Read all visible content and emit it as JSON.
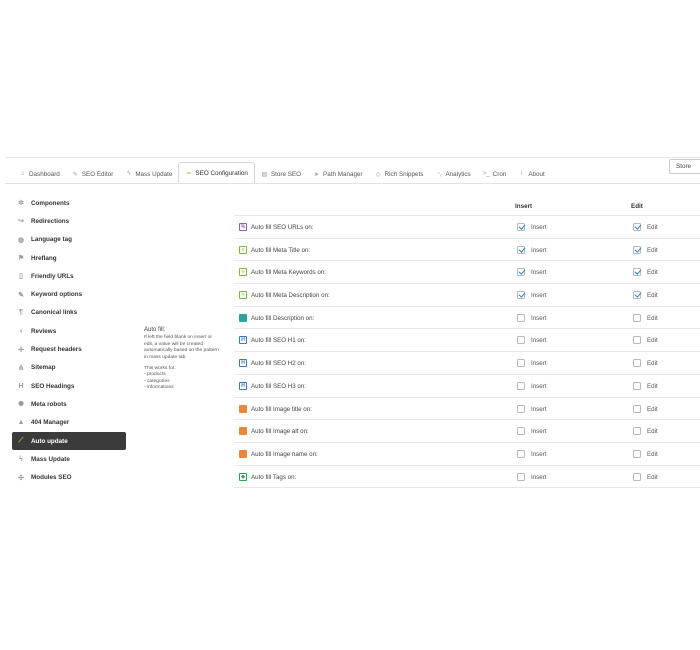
{
  "tabs": [
    {
      "label": "Dashboard",
      "icon": "home-icon"
    },
    {
      "label": "SEO Editor",
      "icon": "edit-icon"
    },
    {
      "label": "Mass Update",
      "icon": "bolt-icon"
    },
    {
      "label": "SEO Configuration",
      "icon": "wrench-icon",
      "active": true
    },
    {
      "label": "Store SEO",
      "icon": "store-icon"
    },
    {
      "label": "Path Manager",
      "icon": "send-icon"
    },
    {
      "label": "Rich Snippets",
      "icon": "tag-icon"
    },
    {
      "label": "Analytics",
      "icon": "chart-icon"
    },
    {
      "label": "Cron",
      "icon": "terminal-icon"
    },
    {
      "label": "About",
      "icon": "info-icon"
    }
  ],
  "store_select": {
    "value": "Store"
  },
  "sidebar": {
    "items": [
      {
        "label": "Components",
        "icon": "gear-icon"
      },
      {
        "label": "Redirections",
        "icon": "share-icon"
      },
      {
        "label": "Language tag",
        "icon": "globe-icon"
      },
      {
        "label": "Hreflang",
        "icon": "flag-icon"
      },
      {
        "label": "Friendly URLs",
        "icon": "file-icon"
      },
      {
        "label": "Keyword options",
        "icon": "edit-icon"
      },
      {
        "label": "Canonical links",
        "icon": "paragraph-icon"
      },
      {
        "label": "Reviews",
        "icon": "comment-icon"
      },
      {
        "label": "Request headers",
        "icon": "crosshair-icon"
      },
      {
        "label": "Sitemap",
        "icon": "sitemap-icon"
      },
      {
        "label": "SEO Headings",
        "icon": "heading-icon"
      },
      {
        "label": "Meta robots",
        "icon": "robot-icon"
      },
      {
        "label": "404 Manager",
        "icon": "warning-icon"
      },
      {
        "label": "Auto update",
        "icon": "wand-icon",
        "active": true
      },
      {
        "label": "Mass Update",
        "icon": "bolt-icon"
      },
      {
        "label": "Modules SEO",
        "icon": "puzzle-icon"
      }
    ]
  },
  "help": {
    "title": "Auto fill:",
    "lines": [
      "If left the field blank on insert or",
      "edit, a value will be created",
      "automatically based on the pattern",
      "in mass update tab."
    ],
    "works_title": "This works for:",
    "works": [
      "- products",
      "- categories",
      "- informations"
    ]
  },
  "table": {
    "insert_header": "Insert",
    "edit_header": "Edit",
    "insert_label": "Insert",
    "edit_label": "Edit",
    "rows": [
      {
        "label": "Auto fill SEO URLs on:",
        "icon": "link-icon",
        "color": "#8a63b8",
        "glyph": "%",
        "insert": true,
        "edit": true
      },
      {
        "label": "Auto fill Meta Title on:",
        "icon": "code-icon",
        "color": "#78b83a",
        "glyph": "‹›",
        "insert": true,
        "edit": true
      },
      {
        "label": "Auto fill Meta Keywords on:",
        "icon": "code-icon",
        "color": "#78b83a",
        "glyph": "‹›",
        "insert": true,
        "edit": true
      },
      {
        "label": "Auto fill Meta Description on:",
        "icon": "code-icon",
        "color": "#78b83a",
        "glyph": "‹›",
        "insert": true,
        "edit": true
      },
      {
        "label": "Auto fill Description on:",
        "icon": "image-icon",
        "color": "#2aa39a",
        "glyph": "▆",
        "insert": false,
        "edit": false
      },
      {
        "label": "Auto fill SEO H1 on:",
        "icon": "heading-icon",
        "color": "#3a78b8",
        "glyph": "H",
        "insert": false,
        "edit": false
      },
      {
        "label": "Auto fill SEO H2 on:",
        "icon": "heading-icon",
        "color": "#3a78b8",
        "glyph": "H",
        "insert": false,
        "edit": false
      },
      {
        "label": "Auto fill SEO H3 on:",
        "icon": "heading-icon",
        "color": "#3a78b8",
        "glyph": "H",
        "insert": false,
        "edit": false
      },
      {
        "label": "Auto fill Image title on:",
        "icon": "image-icon",
        "color": "#e8893a",
        "glyph": "▆",
        "insert": false,
        "edit": false
      },
      {
        "label": "Auto fill Image alt on:",
        "icon": "image-icon",
        "color": "#e8893a",
        "glyph": "▆",
        "insert": false,
        "edit": false
      },
      {
        "label": "Auto fill Image name on:",
        "icon": "image-icon",
        "color": "#e8893a",
        "glyph": "▆",
        "insert": false,
        "edit": false
      },
      {
        "label": "Auto fill Tags on:",
        "icon": "tags-icon",
        "color": "#2aa35a",
        "glyph": "◆",
        "insert": false,
        "edit": false
      }
    ]
  }
}
